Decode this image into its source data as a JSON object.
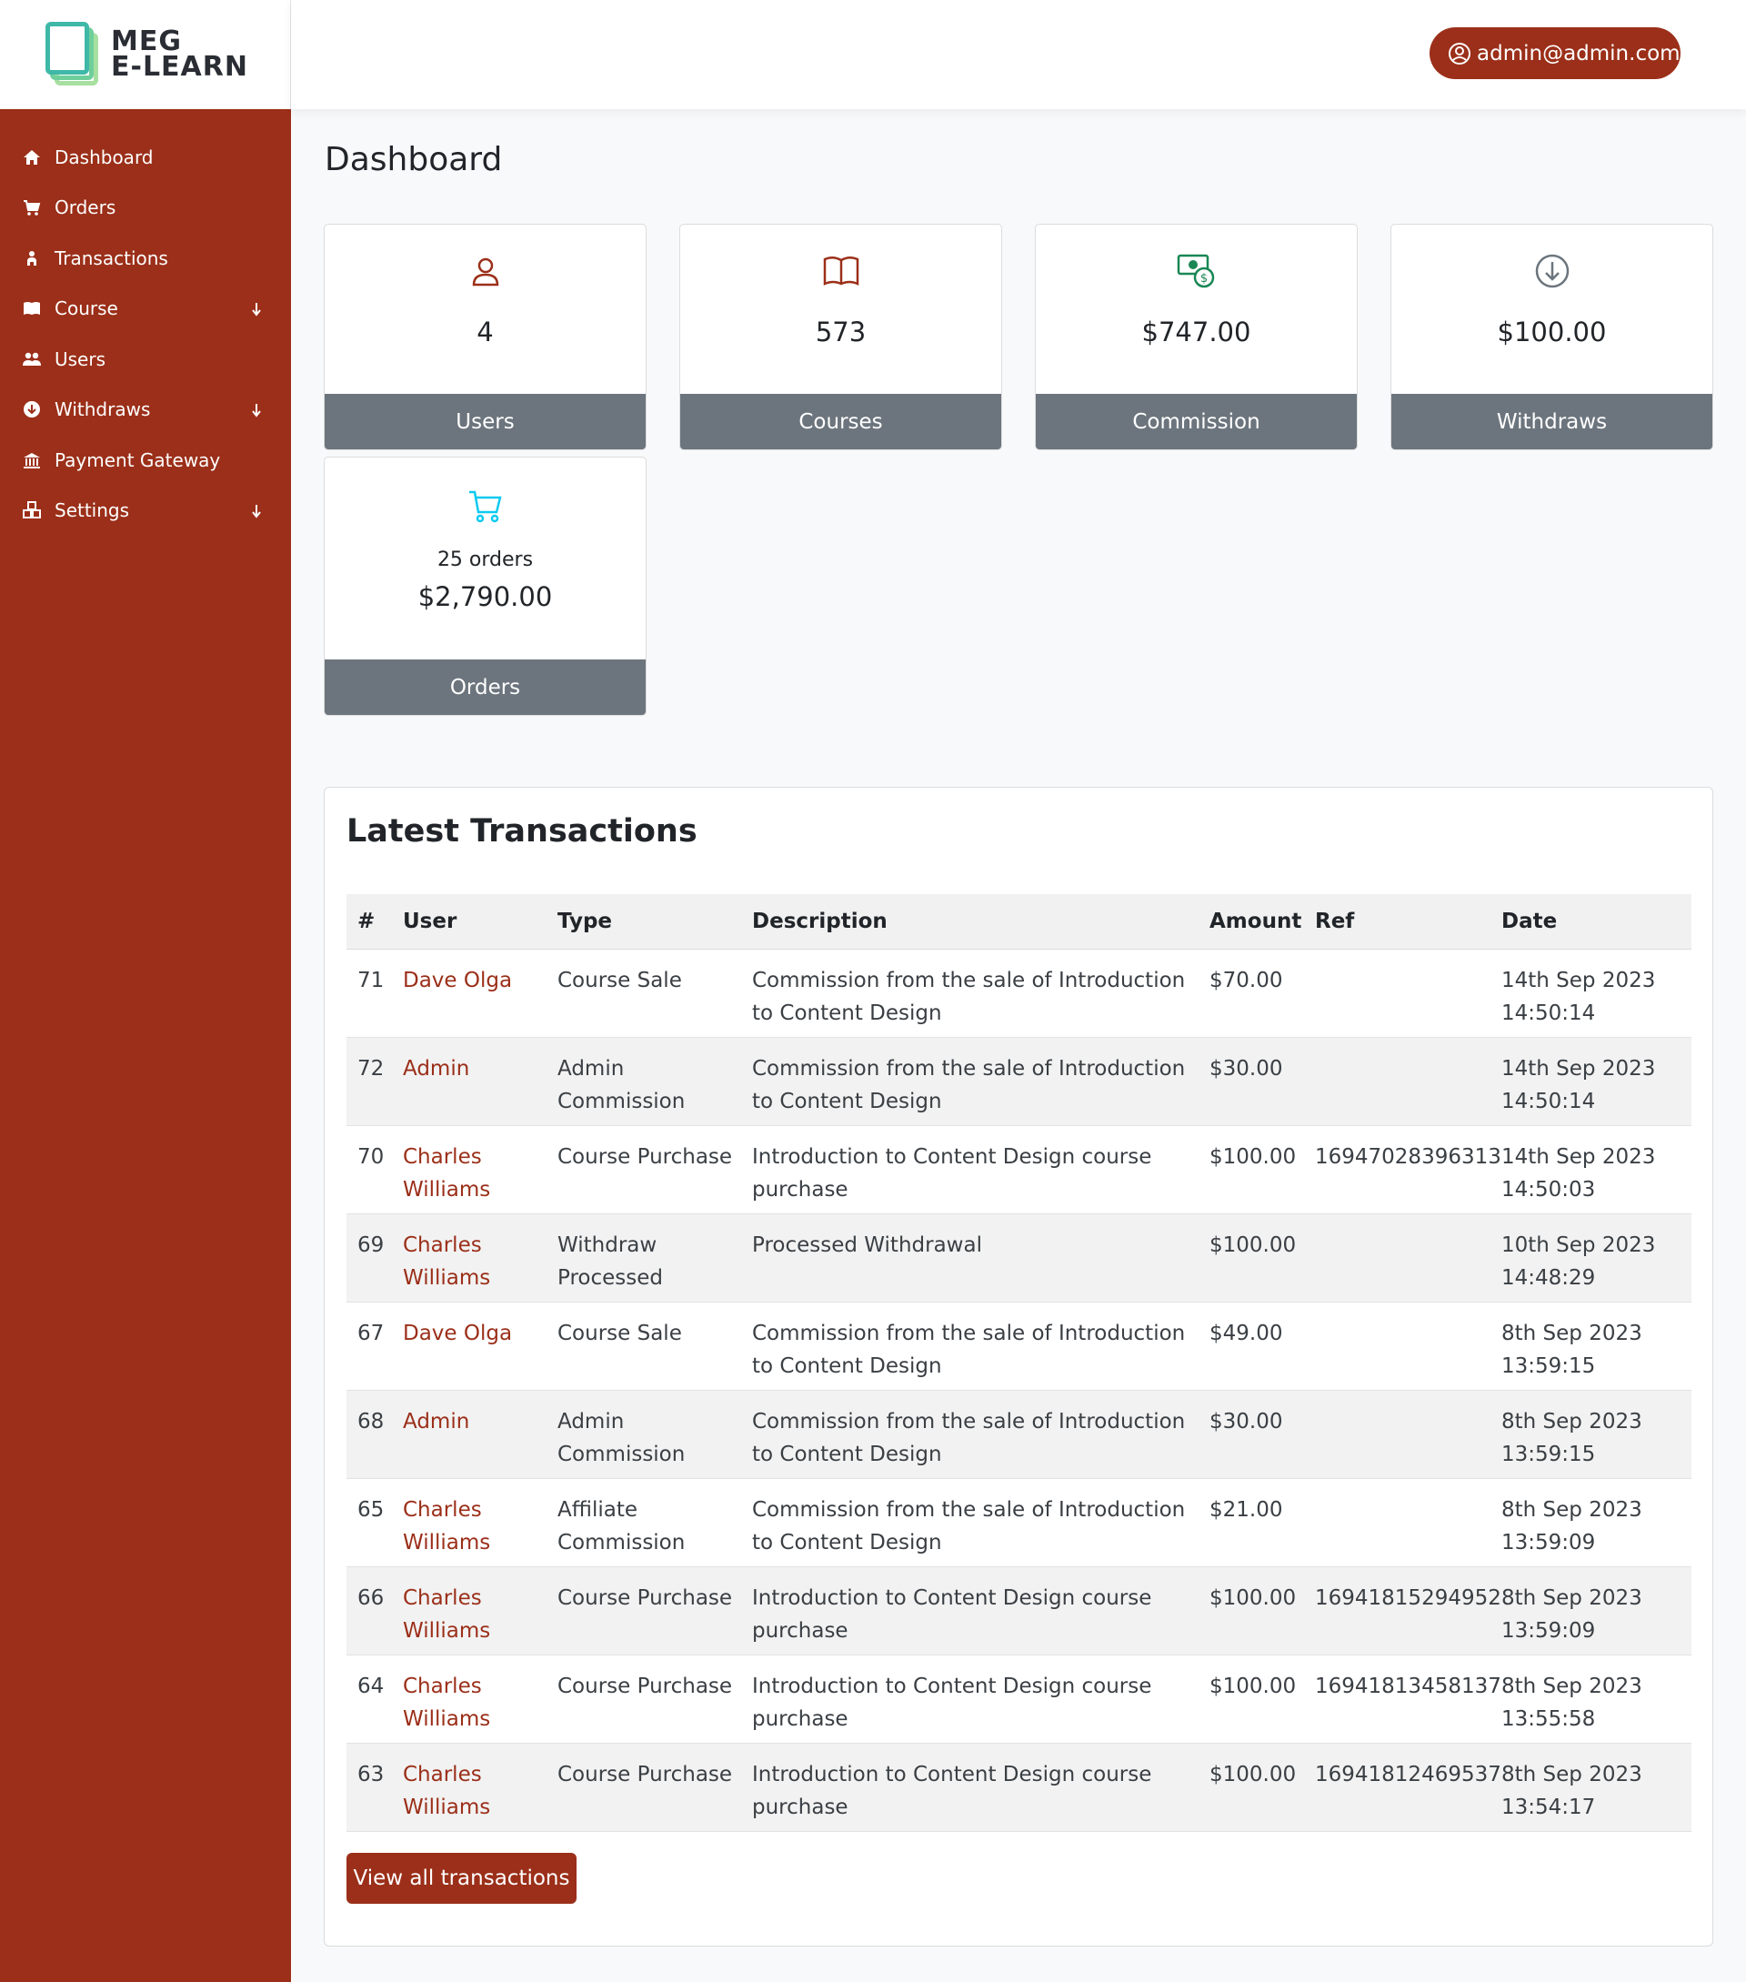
{
  "brand": {
    "line1": "MEG",
    "line2": "E-LEARN"
  },
  "sidebar": {
    "items": [
      {
        "label": "Dashboard",
        "icon": "home-icon"
      },
      {
        "label": "Orders",
        "icon": "cart-icon"
      },
      {
        "label": "Transactions",
        "icon": "user-transfer-icon"
      },
      {
        "label": "Course",
        "icon": "book-icon",
        "expandable": true
      },
      {
        "label": "Users",
        "icon": "users-icon"
      },
      {
        "label": "Withdraws",
        "icon": "arrow-circle-down-icon",
        "expandable": true
      },
      {
        "label": "Payment Gateway",
        "icon": "bank-icon"
      },
      {
        "label": "Settings",
        "icon": "cubes-icon",
        "expandable": true
      }
    ]
  },
  "header": {
    "user_email": "admin@admin.com"
  },
  "page": {
    "title": "Dashboard"
  },
  "stats": {
    "users": {
      "value": "4",
      "label": "Users",
      "icon": "user-icon",
      "color": "#9b2f19"
    },
    "courses": {
      "value": "573",
      "label": "Courses",
      "icon": "book-open-icon",
      "color": "#9b2f19"
    },
    "commission": {
      "value": "$747.00",
      "label": "Commission",
      "icon": "cash-icon",
      "color": "#198754"
    },
    "withdraws": {
      "value": "$100.00",
      "label": "Withdraws",
      "icon": "arrow-down-circle-icon",
      "color": "#6c757d"
    },
    "orders": {
      "count": "25 orders",
      "value": "$2,790.00",
      "label": "Orders",
      "icon": "cart-icon",
      "color": "#0dcaf0"
    }
  },
  "transactions": {
    "title": "Latest Transactions",
    "columns": {
      "id": "#",
      "user": "User",
      "type": "Type",
      "description": "Description",
      "amount": "Amount",
      "ref": "Ref",
      "date": "Date"
    },
    "rows": [
      {
        "id": "71",
        "user": "Dave Olga",
        "type": "Course Sale",
        "description": "Commission from the sale of Introduction to Content Design",
        "amount": "$70.00",
        "ref": "",
        "date": "14th Sep 2023 14:50:14"
      },
      {
        "id": "72",
        "user": "Admin",
        "type": "Admin Commission",
        "description": "Commission from the sale of Introduction to Content Design",
        "amount": "$30.00",
        "ref": "",
        "date": "14th Sep 2023 14:50:14"
      },
      {
        "id": "70",
        "user": "Charles Williams",
        "type": "Course Purchase",
        "description": "Introduction to Content Design course purchase",
        "amount": "$100.00",
        "ref": "16947028396313",
        "date": "14th Sep 2023 14:50:03"
      },
      {
        "id": "69",
        "user": "Charles Williams",
        "type": "Withdraw Processed",
        "description": "Processed Withdrawal",
        "amount": "$100.00",
        "ref": "",
        "date": "10th Sep 2023 14:48:29"
      },
      {
        "id": "67",
        "user": "Dave Olga",
        "type": "Course Sale",
        "description": "Commission from the sale of Introduction to Content Design",
        "amount": "$49.00",
        "ref": "",
        "date": "8th Sep 2023 13:59:15"
      },
      {
        "id": "68",
        "user": "Admin",
        "type": "Admin Commission",
        "description": "Commission from the sale of Introduction to Content Design",
        "amount": "$30.00",
        "ref": "",
        "date": "8th Sep 2023 13:59:15"
      },
      {
        "id": "65",
        "user": "Charles Williams",
        "type": "Affiliate Commission",
        "description": "Commission from the sale of Introduction to Content Design",
        "amount": "$21.00",
        "ref": "",
        "date": "8th Sep 2023 13:59:09"
      },
      {
        "id": "66",
        "user": "Charles Williams",
        "type": "Course Purchase",
        "description": "Introduction to Content Design course purchase",
        "amount": "$100.00",
        "ref": "16941815294952",
        "date": "8th Sep 2023 13:59:09"
      },
      {
        "id": "64",
        "user": "Charles Williams",
        "type": "Course Purchase",
        "description": "Introduction to Content Design course purchase",
        "amount": "$100.00",
        "ref": "16941813458137",
        "date": "8th Sep 2023 13:55:58"
      },
      {
        "id": "63",
        "user": "Charles Williams",
        "type": "Course Purchase",
        "description": "Introduction to Content Design course purchase",
        "amount": "$100.00",
        "ref": "16941812469537",
        "date": "8th Sep 2023 13:54:17"
      }
    ],
    "view_all_label": "View all transactions"
  },
  "colors": {
    "brand": "#9b2f19",
    "card_footer": "#6c757d",
    "logo_teal": "#3fb8a8",
    "logo_green": "#8fd18a"
  }
}
